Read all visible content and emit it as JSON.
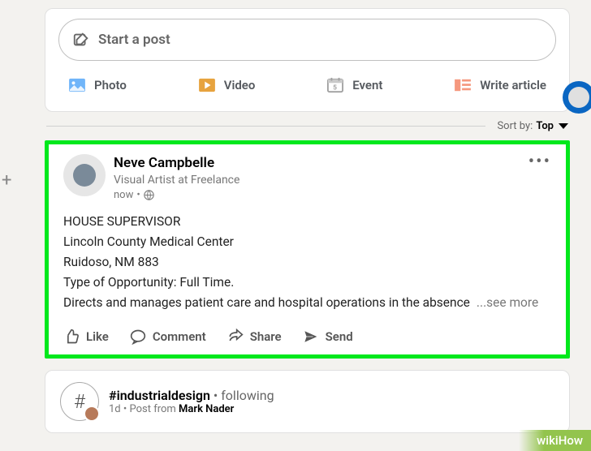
{
  "startPost": {
    "placeholder": "Start a post",
    "actions": {
      "photo": "Photo",
      "video": "Video",
      "event": "Event",
      "article": "Write article"
    }
  },
  "sort": {
    "label": "Sort by:",
    "value": "Top"
  },
  "post": {
    "author": {
      "name": "Neve Campbelle",
      "title": "Visual Artist at Freelance",
      "time": "now"
    },
    "body": {
      "line1": "HOUSE SUPERVISOR",
      "line2": "Lincoln County Medical Center",
      "line3": "Ruidoso, NM 883",
      "line4": "Type of Opportunity: Full Time.",
      "line5": "Directs and manages patient care and hospital operations in the absence",
      "seeMore": "...see more"
    },
    "social": {
      "like": "Like",
      "comment": "Comment",
      "share": "Share",
      "send": "Send"
    }
  },
  "post2": {
    "hashtag": "#industrialdesign",
    "following": " • following",
    "time": "1d • Post from ",
    "from": "Mark Nader"
  },
  "watermark": "wikiHow"
}
